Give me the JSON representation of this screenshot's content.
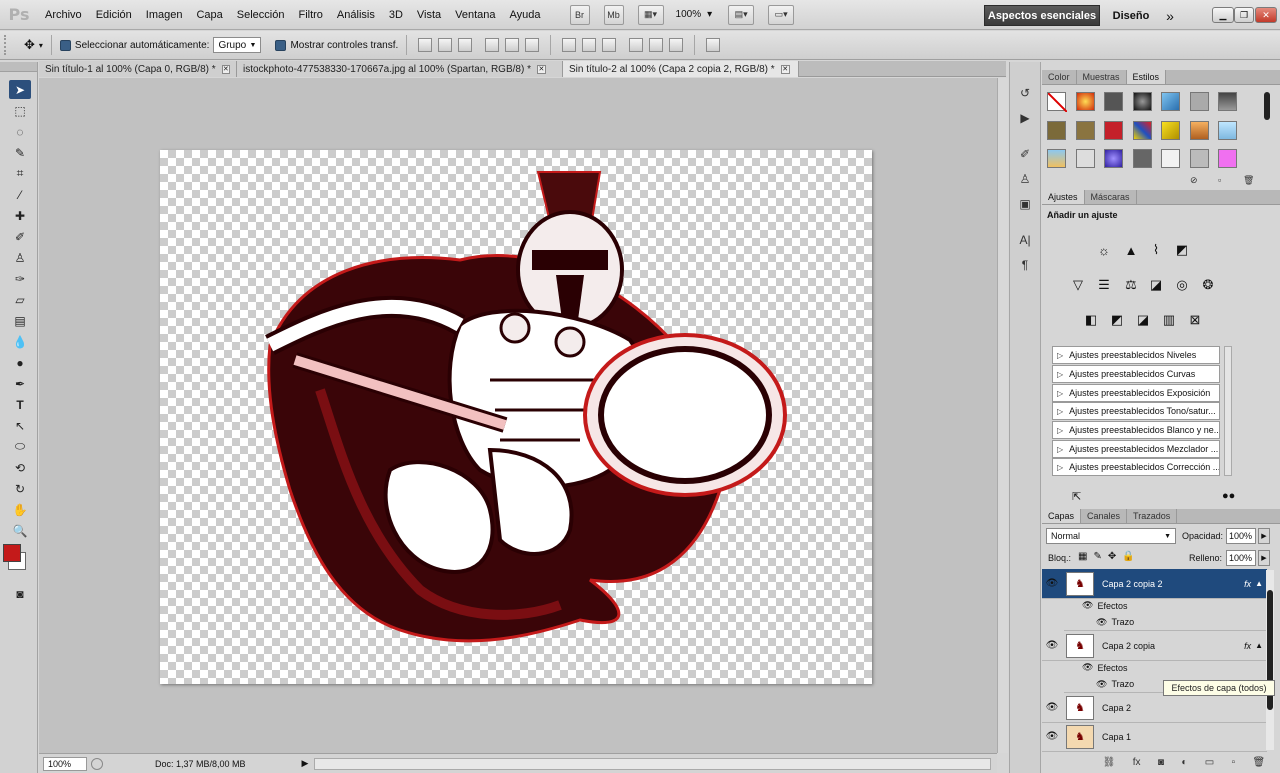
{
  "menubar": {
    "logo": "Ps",
    "items": [
      "Archivo",
      "Edición",
      "Imagen",
      "Capa",
      "Selección",
      "Filtro",
      "Análisis",
      "3D",
      "Vista",
      "Ventana",
      "Ayuda"
    ],
    "bridge_label": "Br",
    "minibridge_label": "Mb",
    "zoom_value": "100%",
    "workspace_active": "Aspectos esenciales",
    "workspace_design": "Diseño",
    "more_label": "»"
  },
  "options": {
    "auto_select_label": "Seleccionar automáticamente:",
    "auto_select_value": "Grupo",
    "show_transform_label": "Mostrar controles transf."
  },
  "document_tabs": [
    {
      "label": "Sin título-1 al 100% (Capa 0, RGB/8) *"
    },
    {
      "label": "istockphoto-477538330-170667a.jpg al 100% (Spartan, RGB/8) *"
    },
    {
      "label": "Sin título-2 al 100% (Capa 2 copia 2, RGB/8) *"
    }
  ],
  "status": {
    "zoom": "100%",
    "doc_info": "Doc: 1,37 MB/8,00 MB"
  },
  "colors": {
    "foreground": "#c41a1a",
    "background": "#ffffff",
    "accent": "#1f4a7d"
  },
  "styles_panel": {
    "tabs": [
      "Color",
      "Muestras",
      "Estilos"
    ],
    "active_tab": "Estilos"
  },
  "adjustments_panel": {
    "tabs": [
      "Ajustes",
      "Máscaras"
    ],
    "title": "Añadir un ajuste",
    "presets": [
      "Ajustes preestablecidos Niveles",
      "Ajustes preestablecidos Curvas",
      "Ajustes preestablecidos Exposición",
      "Ajustes preestablecidos Tono/satur...",
      "Ajustes preestablecidos Blanco y ne...",
      "Ajustes preestablecidos Mezclador ...",
      "Ajustes preestablecidos Corrección ..."
    ]
  },
  "layers_panel": {
    "tabs": [
      "Capas",
      "Canales",
      "Trazados"
    ],
    "blend_mode": "Normal",
    "opacity_label": "Opacidad:",
    "opacity_value": "100%",
    "lock_label": "Bloq.:",
    "fill_label": "Relleno:",
    "fill_value": "100%",
    "layers": [
      {
        "name": "Capa 2 copia 2",
        "fx": "fx",
        "effects_label": "Efectos",
        "effect": "Trazo"
      },
      {
        "name": "Capa 2 copia",
        "fx": "fx",
        "effects_label": "Efectos",
        "effect": "Trazo"
      },
      {
        "name": "Capa 2"
      },
      {
        "name": "Capa 1"
      }
    ],
    "tooltip": "Efectos de capa (todos)"
  }
}
